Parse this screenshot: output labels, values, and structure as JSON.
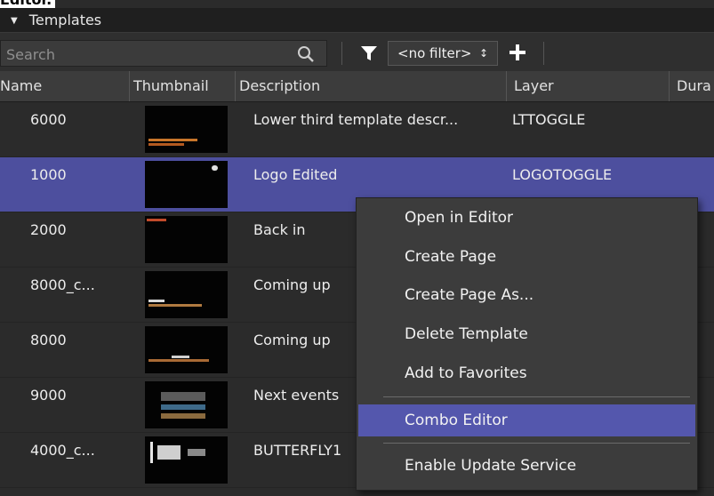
{
  "page_caption": "Editor.",
  "panel": {
    "title": "Templates"
  },
  "toolbar": {
    "search_placeholder": "Search",
    "filter_value": "<no filter>",
    "filter_arrows": "↕"
  },
  "columns": [
    "Name",
    "Thumbnail",
    "Description",
    "Layer",
    "Dura"
  ],
  "rows": [
    {
      "name": "6000",
      "description": "Lower third template descr...",
      "layer": "LTTOGGLE"
    },
    {
      "name": "1000",
      "description": "Logo Edited",
      "layer": "LOGOTOGGLE",
      "selected": true
    },
    {
      "name": "2000",
      "description": "Back in",
      "layer": ""
    },
    {
      "name": "8000_c...",
      "description": "Coming up",
      "layer": ""
    },
    {
      "name": "8000",
      "description": "Coming up",
      "layer": ""
    },
    {
      "name": "9000",
      "description": "Next events",
      "layer": ""
    },
    {
      "name": "4000_c...",
      "description": "BUTTERFLY1",
      "layer": ""
    }
  ],
  "context_menu": {
    "items": [
      "Open in Editor",
      "Create Page",
      "Create Page As...",
      "Delete Template",
      "Add to Favorites",
      "Combo Editor",
      "Enable Update Service"
    ],
    "highlighted": "Combo Editor"
  },
  "colors": {
    "selection": "#4d4f9e",
    "menu_highlight": "#5457ad",
    "background": "#2b2b2b"
  }
}
